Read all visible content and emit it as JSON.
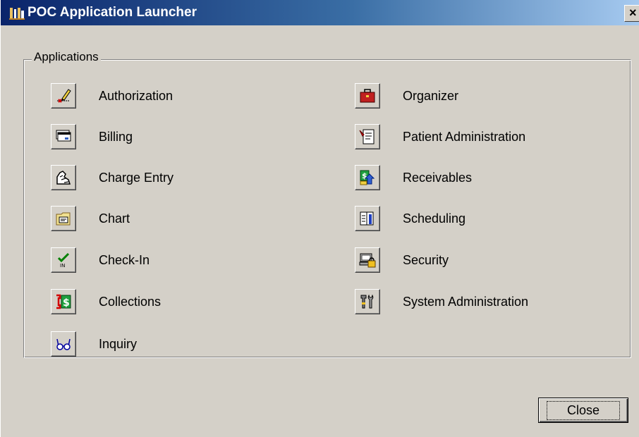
{
  "window": {
    "title": "POC Application Launcher",
    "close_glyph": "×"
  },
  "group": {
    "label": "Applications"
  },
  "apps_left": [
    {
      "label": "Authorization",
      "icon": "authorization-icon"
    },
    {
      "label": "Billing",
      "icon": "billing-icon"
    },
    {
      "label": "Charge Entry",
      "icon": "charge-entry-icon"
    },
    {
      "label": "Chart",
      "icon": "chart-folder-icon"
    },
    {
      "label": "Check-In",
      "icon": "check-in-icon"
    },
    {
      "label": "Collections",
      "icon": "collections-icon"
    },
    {
      "label": "Inquiry",
      "icon": "inquiry-glasses-icon"
    }
  ],
  "apps_right": [
    {
      "label": "Organizer",
      "icon": "organizer-briefcase-icon"
    },
    {
      "label": "Patient Administration",
      "icon": "patient-administration-icon"
    },
    {
      "label": "Receivables",
      "icon": "receivables-icon"
    },
    {
      "label": "Scheduling",
      "icon": "scheduling-icon"
    },
    {
      "label": "Security",
      "icon": "security-lock-icon"
    },
    {
      "label": "System Administration",
      "icon": "system-administration-tools-icon"
    }
  ],
  "footer": {
    "close_label": "Close"
  },
  "colors": {
    "title_start": "#0a246a",
    "title_end": "#a6caf0",
    "face": "#d4d0c8"
  }
}
